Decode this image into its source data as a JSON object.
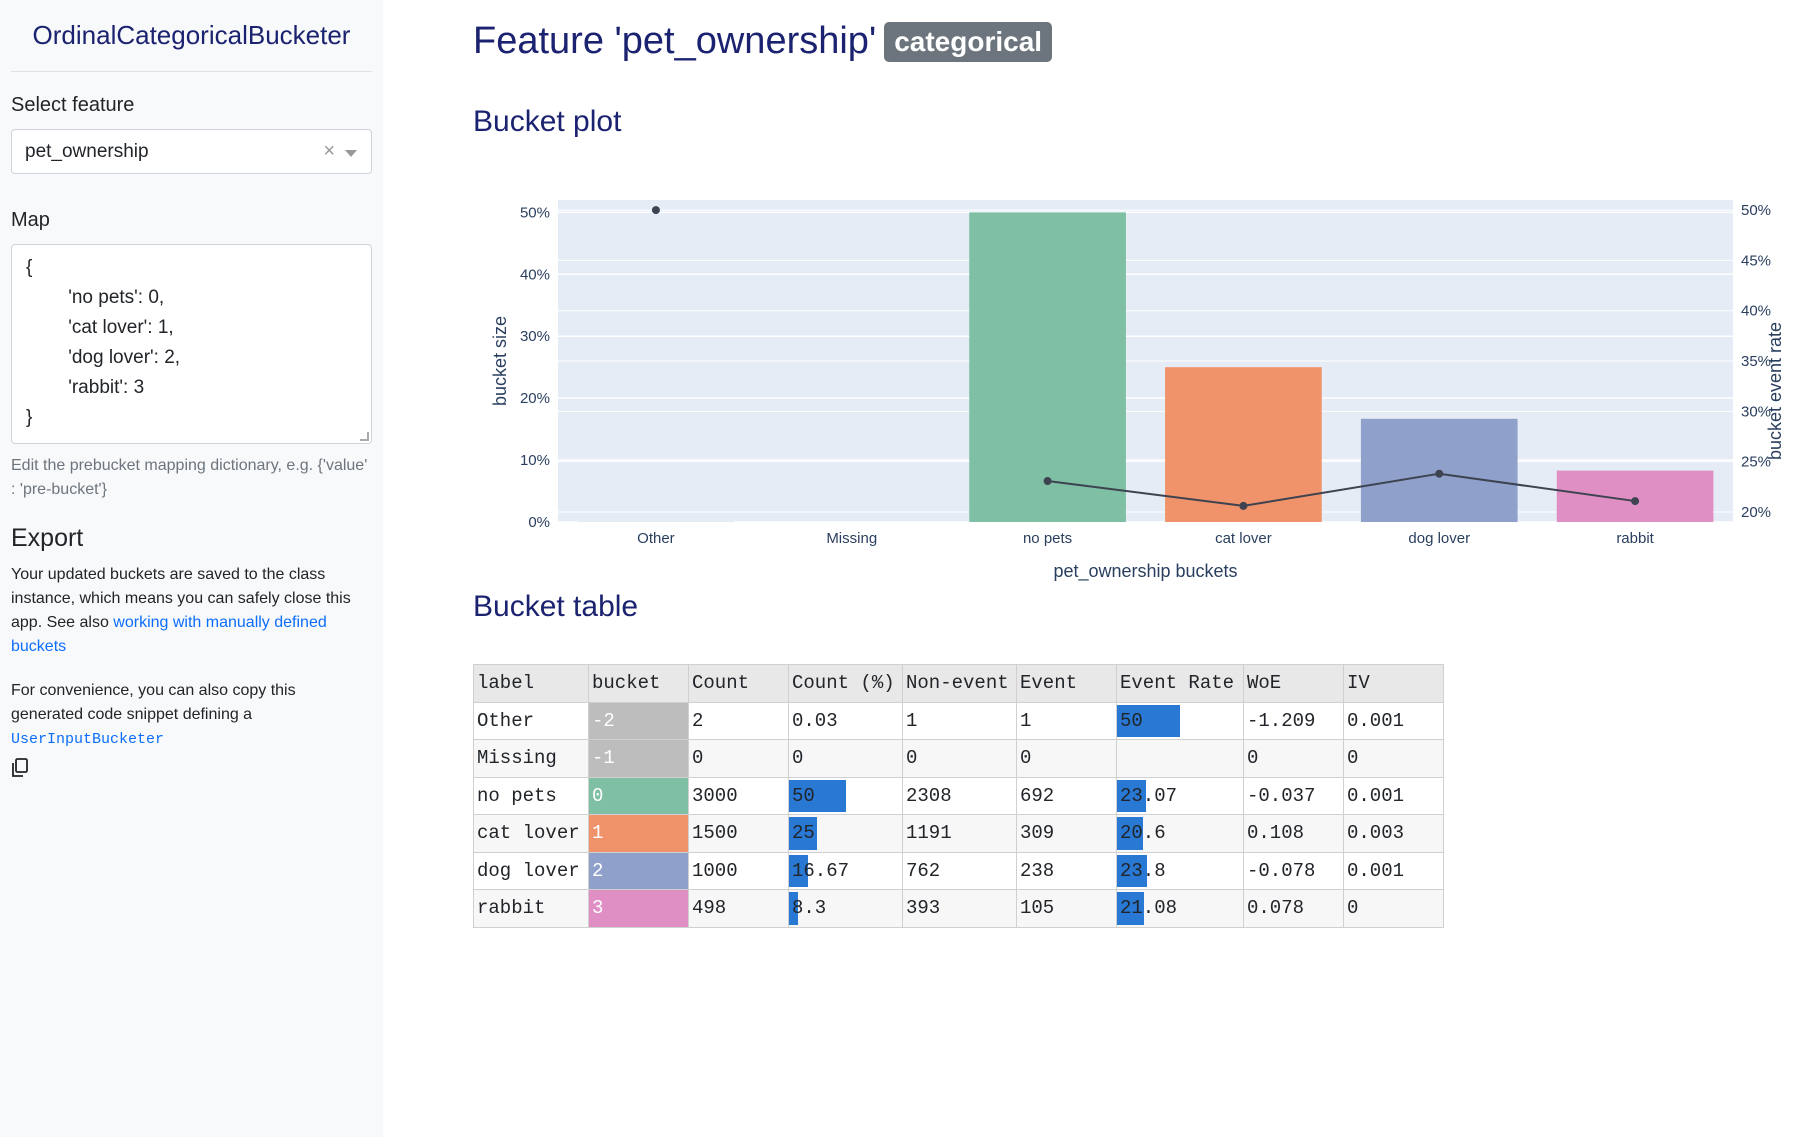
{
  "sidebar": {
    "title": "OrdinalCategoricalBucketer",
    "select_label": "Select feature",
    "select_value": "pet_ownership",
    "clear_symbol": "×",
    "map_label": "Map",
    "map_text": "{\n        'no pets': 0,\n        'cat lover': 1,\n        'dog lover': 2,\n        'rabbit': 3\n}",
    "map_help": "Edit the prebucket mapping dictionary, e.g. {'value' : 'pre-bucket'}",
    "export_title": "Export",
    "export_text": "Your updated buckets are saved to the class instance, which means you can safely close this app. See also ",
    "export_link": "working with manually defined buckets",
    "copy_text": "For convenience, you can also copy this generated code snippet defining a",
    "copy_code": "UserInputBucketer"
  },
  "main": {
    "feature_title": "Feature 'pet_ownership'",
    "feature_badge": "categorical",
    "plot_title": "Bucket plot",
    "table_title": "Bucket table"
  },
  "chart_data": {
    "type": "bar",
    "categories": [
      "Other",
      "Missing",
      "no pets",
      "cat lover",
      "dog lover",
      "rabbit"
    ],
    "values": [
      0.03,
      0,
      50,
      25,
      16.67,
      8.3
    ],
    "bar_colors": [
      "#7fbfa4",
      "#7fbfa4",
      "#7fbfa4",
      "#f0936a",
      "#8fa0cb",
      "#e08fc4"
    ],
    "line": {
      "categories": [
        "Other",
        "no pets",
        "cat lover",
        "dog lover",
        "rabbit"
      ],
      "values": [
        50,
        23.07,
        20.6,
        23.8,
        21.08
      ]
    },
    "xlabel": "pet_ownership buckets",
    "ylabel": "bucket size",
    "y2label": "bucket event rate",
    "ylim": [
      0,
      52
    ],
    "y2lim": [
      19,
      51
    ],
    "yticks": [
      "0%",
      "10%",
      "20%",
      "30%",
      "40%",
      "50%"
    ],
    "yticks_values": [
      0,
      10,
      20,
      30,
      40,
      50
    ],
    "y2ticks": [
      "20%",
      "25%",
      "30%",
      "35%",
      "40%",
      "45%",
      "50%"
    ],
    "y2ticks_values": [
      20,
      25,
      30,
      35,
      40,
      45,
      50
    ],
    "plot_bg": "#e5ecf6",
    "line_color": "#3d4350"
  },
  "table": {
    "headers": [
      "label",
      "bucket",
      "Count",
      "Count (%)",
      "Non-event",
      "Event",
      "Event Rate",
      "WoE",
      "IV"
    ],
    "rows": [
      {
        "label": "Other",
        "bucket": "-2",
        "bucket_color": "#bdbdbd",
        "count": "2",
        "count_pct": "0.03",
        "count_pct_v": 0.03,
        "non_event": "1",
        "event": "1",
        "event_rate": "50",
        "event_rate_v": 50,
        "woe": "-1.209",
        "iv": "0.001"
      },
      {
        "label": "Missing",
        "bucket": "-1",
        "bucket_color": "#bdbdbd",
        "count": "0",
        "count_pct": "0",
        "count_pct_v": 0,
        "non_event": "0",
        "event": "0",
        "event_rate": "",
        "event_rate_v": 0,
        "woe": "0",
        "iv": "0"
      },
      {
        "label": "no pets",
        "bucket": "0",
        "bucket_color": "#7fbfa4",
        "count": "3000",
        "count_pct": "50",
        "count_pct_v": 50,
        "non_event": "2308",
        "event": "692",
        "event_rate": "23.07",
        "event_rate_v": 23.07,
        "woe": "-0.037",
        "iv": "0.001"
      },
      {
        "label": "cat lover",
        "bucket": "1",
        "bucket_color": "#f0936a",
        "count": "1500",
        "count_pct": "25",
        "count_pct_v": 25,
        "non_event": "1191",
        "event": "309",
        "event_rate": "20.6",
        "event_rate_v": 20.6,
        "woe": "0.108",
        "iv": "0.003"
      },
      {
        "label": "dog lover",
        "bucket": "2",
        "bucket_color": "#8fa0cb",
        "count": "1000",
        "count_pct": "16.67",
        "count_pct_v": 16.67,
        "non_event": "762",
        "event": "238",
        "event_rate": "23.8",
        "event_rate_v": 23.8,
        "woe": "-0.078",
        "iv": "0.001"
      },
      {
        "label": "rabbit",
        "bucket": "3",
        "bucket_color": "#e08fc4",
        "count": "498",
        "count_pct": "8.3",
        "count_pct_v": 8.3,
        "non_event": "393",
        "event": "105",
        "event_rate": "21.08",
        "event_rate_v": 21.08,
        "woe": "0.078",
        "iv": "0"
      }
    ]
  }
}
